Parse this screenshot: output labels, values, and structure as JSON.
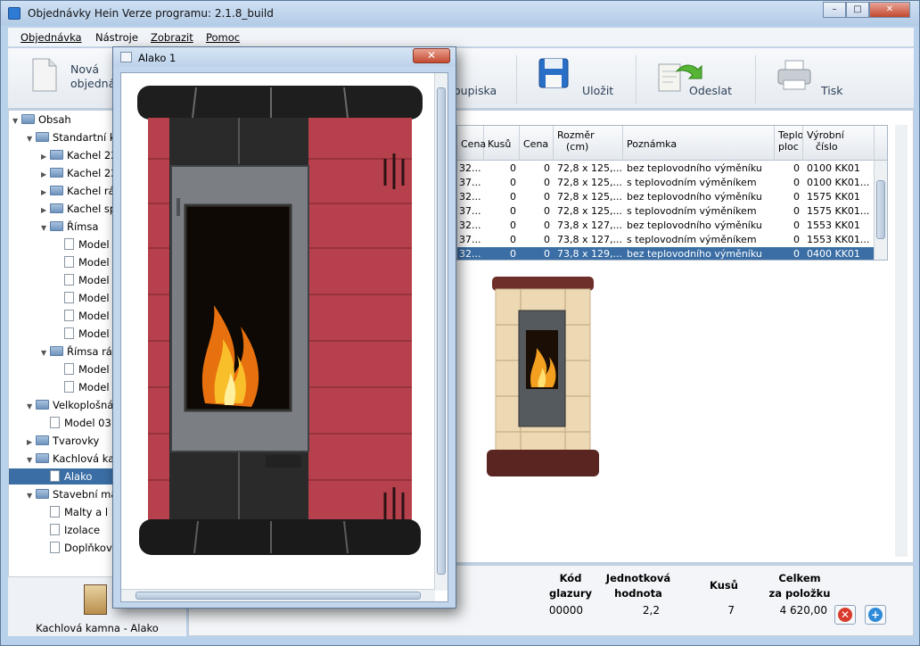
{
  "window": {
    "title": "Objednávky Hein   Verze programu: 2.1.8_build",
    "minimize": "–",
    "maximize": "□",
    "close": "✕"
  },
  "menu": [
    {
      "label": "Objednávka"
    },
    {
      "label": "Nástroje"
    },
    {
      "label": "Zobrazit"
    },
    {
      "label": "Pomoc"
    }
  ],
  "toolbar": {
    "new_order_line1": "Nová",
    "new_order_line2": "objednávka",
    "list_label": "oupiska",
    "save_label": "Uložit",
    "send_label": "Odeslat",
    "print_label": "Tisk"
  },
  "tree": [
    {
      "label": "Obsah",
      "type": "folder",
      "toggle": "▼"
    },
    {
      "label": "Standartní kachle",
      "type": "folder",
      "toggle": "▼"
    },
    {
      "label": "Kachel 22",
      "type": "folder",
      "toggle": "▶"
    },
    {
      "label": "Kachel 22",
      "type": "folder",
      "toggle": "▶"
    },
    {
      "label": "Kachel rá",
      "type": "folder",
      "toggle": "▶"
    },
    {
      "label": "Kachel sp",
      "type": "folder",
      "toggle": "▶"
    },
    {
      "label": "Římsa",
      "type": "folder",
      "toggle": "▼"
    },
    {
      "label": "Model",
      "type": "doc",
      "toggle": ""
    },
    {
      "label": "Model",
      "type": "doc",
      "toggle": ""
    },
    {
      "label": "Model",
      "type": "doc",
      "toggle": ""
    },
    {
      "label": "Model",
      "type": "doc",
      "toggle": ""
    },
    {
      "label": "Model",
      "type": "doc",
      "toggle": ""
    },
    {
      "label": "Model",
      "type": "doc",
      "toggle": ""
    },
    {
      "label": "Římsa rá",
      "type": "folder",
      "toggle": "▼"
    },
    {
      "label": "Model",
      "type": "doc",
      "toggle": ""
    },
    {
      "label": "Model",
      "type": "doc",
      "toggle": ""
    },
    {
      "label": "Velkoplošná",
      "type": "folder",
      "toggle": "▼"
    },
    {
      "label": "Model 03",
      "type": "doc",
      "toggle": ""
    },
    {
      "label": "Tvarovky",
      "type": "folder",
      "toggle": "▶"
    },
    {
      "label": "Kachlová ka",
      "type": "folder",
      "toggle": "▼"
    },
    {
      "label": "Alako",
      "type": "doc",
      "toggle": "",
      "selected": true
    },
    {
      "label": "Stavební ma",
      "type": "folder",
      "toggle": "▼"
    },
    {
      "label": "Malty a l",
      "type": "doc",
      "toggle": ""
    },
    {
      "label": "Izolace",
      "type": "doc",
      "toggle": ""
    },
    {
      "label": "Doplňkov",
      "type": "doc",
      "toggle": ""
    }
  ],
  "left_caption": "Kachlová kamna - Alako",
  "grid": {
    "headers": {
      "cena1": "Cena",
      "kusu": "Kusů",
      "cena2": "Cena",
      "rozmer1": "Rozměr",
      "rozmer2": "(cm)",
      "poznamka": "Poznámka",
      "teplo1": "Teplo",
      "teplo2": "ploc",
      "vyrobni1": "Výrobní",
      "vyrobni2": "číslo"
    },
    "rows": [
      {
        "c1": "32...",
        "kusu": "0",
        "cena": "0",
        "rozmer": "72,8 x 125,...",
        "pozn": "bez teplovodního výměníku",
        "teplo": "0",
        "vc": "0100 KK01"
      },
      {
        "c1": "37...",
        "kusu": "0",
        "cena": "0",
        "rozmer": "72,8 x 125,...",
        "pozn": "s teplovodním výměníkem",
        "teplo": "0",
        "vc": "0100 KK01..."
      },
      {
        "c1": "32...",
        "kusu": "0",
        "cena": "0",
        "rozmer": "72,8 x 125,...",
        "pozn": "bez teplovodního výměníku",
        "teplo": "0",
        "vc": "1575 KK01"
      },
      {
        "c1": "37...",
        "kusu": "0",
        "cena": "0",
        "rozmer": "72,8 x 125,...",
        "pozn": "s teplovodním výměníkem",
        "teplo": "0",
        "vc": "1575 KK01..."
      },
      {
        "c1": "32...",
        "kusu": "0",
        "cena": "0",
        "rozmer": "73,8 x 127,...",
        "pozn": "bez teplovodního výměníku",
        "teplo": "0",
        "vc": "1553 KK01"
      },
      {
        "c1": "37...",
        "kusu": "0",
        "cena": "0",
        "rozmer": "73,8 x 127,...",
        "pozn": "s teplovodním výměníkem",
        "teplo": "0",
        "vc": "1553 KK01..."
      },
      {
        "c1": "32...",
        "kusu": "0",
        "cena": "0",
        "rozmer": "73,8 x 129,...",
        "pozn": "bez teplovodního výměníku",
        "teplo": "0",
        "vc": "0400 KK01",
        "selected": true
      }
    ]
  },
  "footer": {
    "headers": {
      "kod1": "Kód",
      "kod2": "glazury",
      "jed1": "Jednotková",
      "jed2": "hodnota",
      "kusu": "Kusů",
      "cel1": "Celkem",
      "cel2": "za položku"
    },
    "values": {
      "kod": "00000",
      "jed": "2,2",
      "kusu": "7",
      "cel": "4 620,00"
    }
  },
  "popup": {
    "title": "Alako 1",
    "close": "✕"
  },
  "colors": {
    "selection": "#3a6ea5",
    "stove_body": "#b0404b",
    "stove_tile_beige": "#e9d4ad"
  }
}
